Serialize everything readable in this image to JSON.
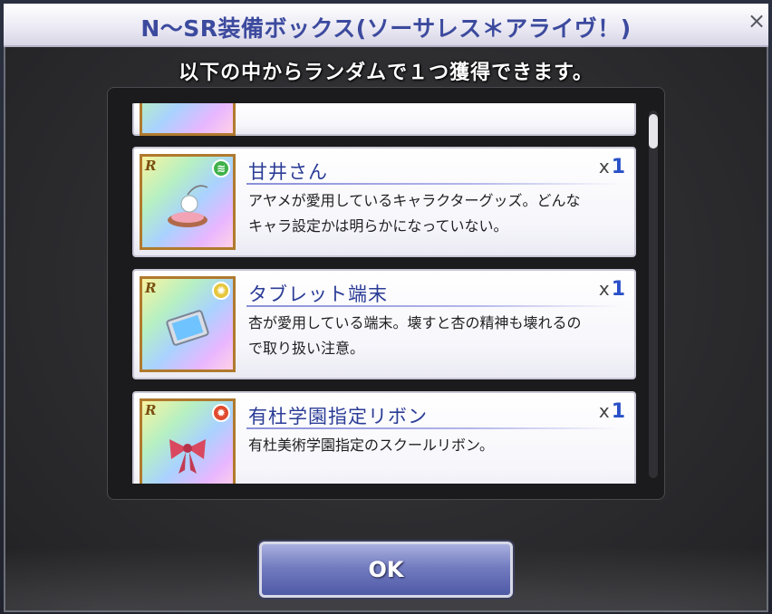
{
  "dialog": {
    "title": "N～SR装備ボックス(ソーサレス＊アライヴ！)",
    "subtitle": "以下の中からランダムで１つ獲得できます。",
    "ok_label": "OK"
  },
  "items": [
    {
      "rarity": "R",
      "element_icon": "wind-element-icon",
      "element_color": "#3fb14a",
      "name": "甘井さん",
      "qty_prefix": "x",
      "qty": "1",
      "description": "アヤメが愛用しているキャラクターグッズ。どんな\nキャラ設定かは明らかになっていない。"
    },
    {
      "rarity": "R",
      "element_icon": "light-element-icon",
      "element_color": "#e6c63a",
      "name": "タブレット端末",
      "qty_prefix": "x",
      "qty": "1",
      "description": "杏が愛用している端末。壊すと杏の精神も壊れるの\nで取り扱い注意。"
    },
    {
      "rarity": "R",
      "element_icon": "fire-element-icon",
      "element_color": "#e04a2e",
      "name": "有杜学園指定リボン",
      "qty_prefix": "x",
      "qty": "1",
      "description": "有杜美術学園指定のスクールリボン。"
    }
  ],
  "colors": {
    "title_text": "#3c4a9e",
    "item_name": "#2b3c96",
    "qty_number": "#2950c8",
    "frame_gold": "#b07a2e"
  }
}
